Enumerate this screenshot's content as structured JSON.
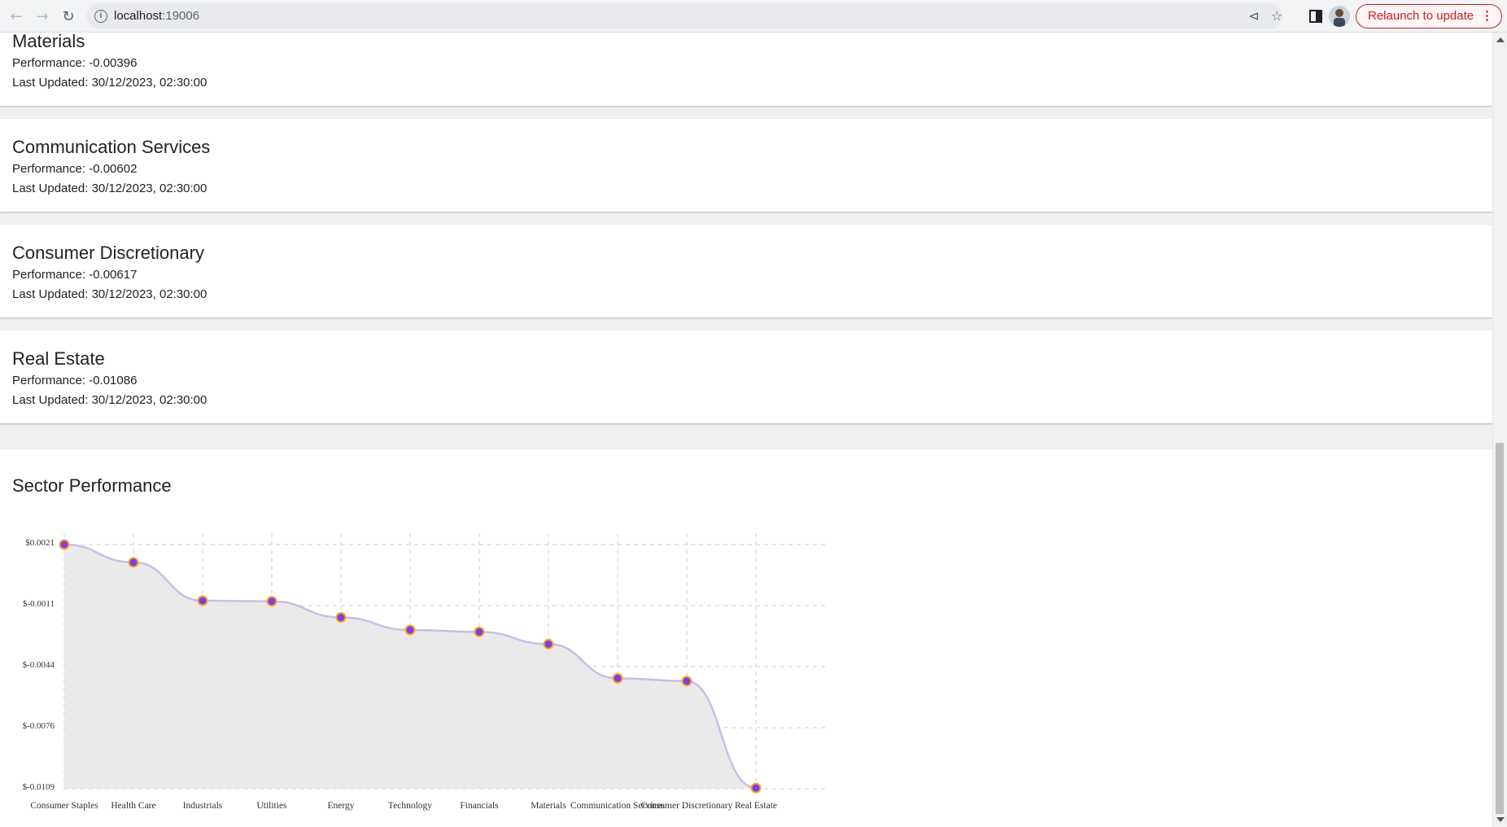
{
  "browser": {
    "url_host": "localhost",
    "url_port": ":19006",
    "relaunch_label": "Relaunch to update"
  },
  "sectors": [
    {
      "name": "Materials",
      "performance": "Performance: -0.00396",
      "updated": "Last Updated: 30/12/2023, 02:30:00"
    },
    {
      "name": "Communication Services",
      "performance": "Performance: -0.00602",
      "updated": "Last Updated: 30/12/2023, 02:30:00"
    },
    {
      "name": "Consumer Discretionary",
      "performance": "Performance: -0.00617",
      "updated": "Last Updated: 30/12/2023, 02:30:00"
    },
    {
      "name": "Real Estate",
      "performance": "Performance: -0.01086",
      "updated": "Last Updated: 30/12/2023, 02:30:00"
    }
  ],
  "chart_title": "Sector Performance",
  "chart_data": {
    "type": "area",
    "title": "Sector Performance",
    "categories": [
      "Consumer Staples",
      "Health Care",
      "Industrials",
      "Utilities",
      "Energy",
      "Technology",
      "Financials",
      "Materials",
      "Communication Services",
      "Consumer Discretionary",
      "Real Estate"
    ],
    "values": [
      0.0021,
      0.00115,
      -0.00089,
      -0.00092,
      -0.00178,
      -0.00245,
      -0.00255,
      -0.0032,
      -0.00502,
      -0.00517,
      -0.01086
    ],
    "yticks": [
      "$0.0021",
      "$-0.0011",
      "$-0.0044",
      "$-0.0076",
      "$-0.0109"
    ],
    "ylim": [
      -0.0109,
      0.0021
    ],
    "grid": true,
    "colors": {
      "line": "#c9bde8",
      "fill": "#e6e6e6",
      "point": "#7b3fe4",
      "point_stroke": "#f5a623"
    }
  }
}
